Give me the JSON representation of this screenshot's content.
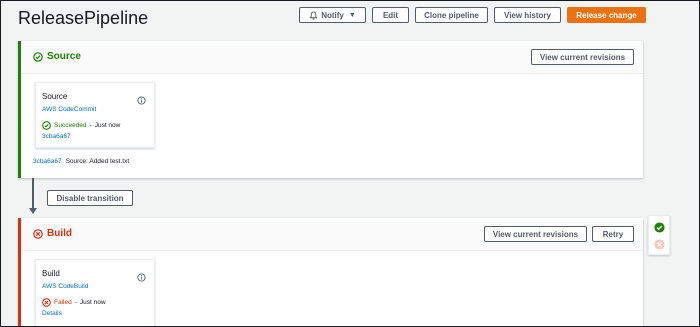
{
  "pipeline": {
    "title": "ReleasePipeline"
  },
  "toolbar": {
    "notify_label": "Notify",
    "edit_label": "Edit",
    "clone_label": "Clone pipeline",
    "history_label": "View history",
    "release_label": "Release change"
  },
  "stages": [
    {
      "name": "Source",
      "status": "succeeded",
      "color": "#1d8102",
      "view_revisions_label": "View current revisions",
      "action": {
        "name": "Source",
        "provider": "AWS CodeCommit",
        "status_text": "Succeeded",
        "time": "Just now",
        "revision": "3cba6a67"
      },
      "revision_summary": {
        "id": "3cba6a67",
        "message": "Source: Added test.txt"
      }
    },
    {
      "name": "Build",
      "status": "failed",
      "color": "#d13212",
      "view_revisions_label": "View current revisions",
      "retry_label": "Retry",
      "action": {
        "name": "Build",
        "provider": "AWS CodeBuild",
        "status_text": "Failed",
        "time": "Just now",
        "details_label": "Details"
      }
    }
  ],
  "transition": {
    "disable_label": "Disable transition"
  },
  "icons": {
    "bell": "bell-icon",
    "caret": "caret-down-icon",
    "success": "check-circle-icon",
    "failure": "x-circle-icon",
    "info": "info-icon",
    "arrow": "arrow-down-icon"
  }
}
